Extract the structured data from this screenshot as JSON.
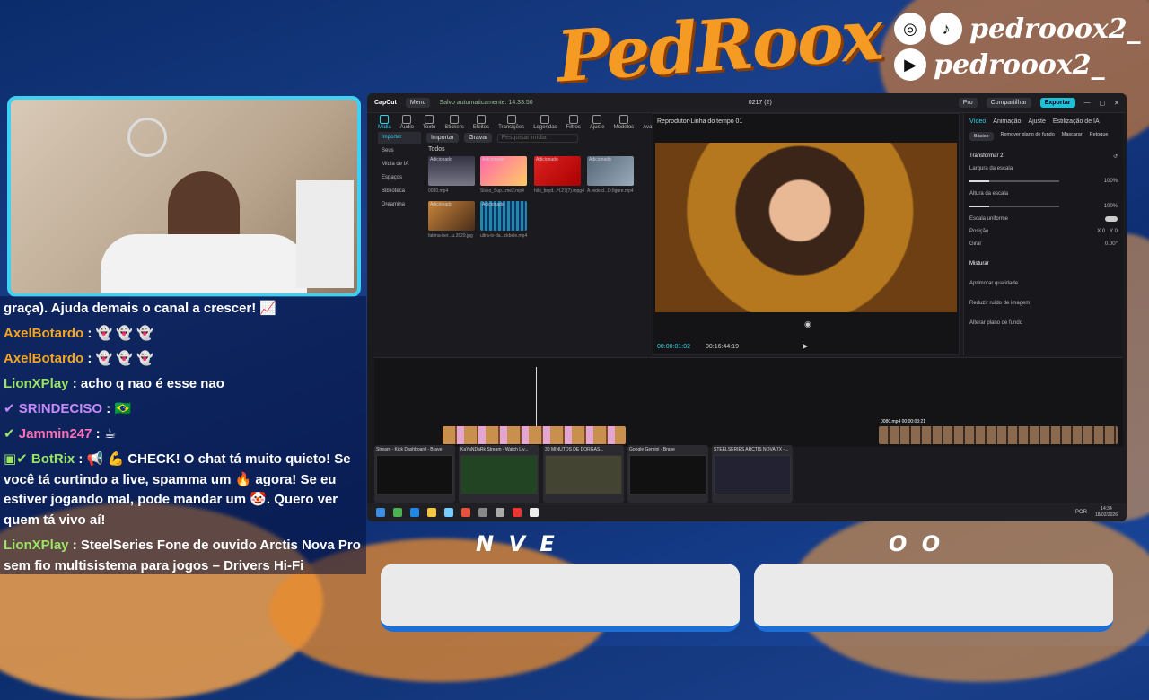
{
  "brand": {
    "logo": "PedRoox",
    "handle_1": "pedrooox2_",
    "handle_2": "pedrooox2_"
  },
  "chat": {
    "messages": [
      {
        "user": "",
        "text": "graça). Ajuda demais o canal a crescer! 📈"
      },
      {
        "user": "AxelBotardo",
        "text": "👻 👻 👻"
      },
      {
        "user": "AxelBotardo",
        "text": "👻 👻 👻"
      },
      {
        "user": "LionXPlay",
        "text": "acho q nao é esse nao"
      },
      {
        "user": "SRINDECISO",
        "text": "🇧🇷"
      },
      {
        "user": "Jammin247",
        "text": "☕"
      },
      {
        "user": "BotRix",
        "text": "📢 💪 CHECK! O chat tá muito quieto! Se você tá curtindo a live, spamma um 🔥 agora! Se eu estiver jogando mal, pode mandar um 🤡. Quero ver quem tá vivo aí!"
      },
      {
        "user": "LionXPlay",
        "text": "SteelSeries Fone de ouvido Arctis Nova Pro sem fio multisistema para jogos – Drivers Hi-Fi premium"
      }
    ]
  },
  "app": {
    "autosave": "Salvo automaticamente: 14:33:50",
    "project": "0217 (2)",
    "menu": "Menu",
    "pro": "Pro",
    "share": "Compartilhar",
    "export": "Exportar",
    "tools": [
      "Mídia",
      "Áudio",
      "Texto",
      "Stickers",
      "Efeitos",
      "Transições",
      "Legendas",
      "Filtros",
      "Ajuste",
      "Modelos",
      "Avatar de IA"
    ],
    "sidebar": [
      "Importar",
      "Seus",
      "Mídia de IA",
      "Espaços",
      "Biblioteca",
      "Dreamina"
    ],
    "lib_header": "Todos",
    "import_btn": "Importar",
    "record_btn": "Gravar",
    "search_ph": "Pesquisar mídia",
    "thumbs": [
      "0080.mp4",
      "Sisko_Sup...me2.mp4",
      "hilo_bsyd...H.27(7).mpg4",
      "A.rede.d...D.figure.mp4",
      "fatima-ber...u.2629.jpg",
      "ultra-tv-da...ckbele.mp4"
    ],
    "added": "Adicionado",
    "player_title": "Reprodutor-Linha do tempo 01",
    "tc_current": "00:00:01:02",
    "tc_total": "00:16:44:19",
    "insp_tabs": [
      "Vídeo",
      "Animação",
      "Ajuste",
      "Estilização de IA"
    ],
    "insp_sub": [
      "Básico",
      "Remover plano de fundo",
      "Mascarar",
      "Retoque"
    ],
    "transform": "Transformar 2",
    "scale_w": "Largura da escala",
    "scale_h": "Altura da escala",
    "pct": "100%",
    "uniform": "Escala uniforme",
    "position": "Posição",
    "rotate": "Girar",
    "rot_val": "0.00°",
    "blend": "Misturar",
    "enhance": "Aprimorar qualidade",
    "noise": "Reduzir ruído de imagem",
    "bg": "Alterar plano de fundo",
    "clip_right": "0080.mp4  00:00:03:21"
  },
  "tasks": [
    "Stream - Kick Dashboard - Brave",
    "KaYaNDaRk Stream - Watch Liv...",
    "30 MINUTOS DE DORGAS...",
    "Google Gemini - Brave",
    "STEELSERIES ARCTIS NOVA 7X -..."
  ],
  "clock": {
    "time": "14:34",
    "date": "18/02/2026",
    "lang": "POR"
  },
  "overlay": {
    "left_letters": "N V   E",
    "right_letters": "O O"
  }
}
